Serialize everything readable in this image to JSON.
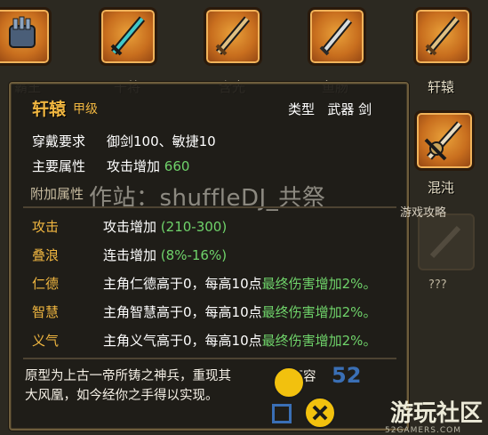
{
  "top_items": [
    {
      "label": "霸王",
      "icon": "gauntlet-icon"
    },
    {
      "label": "干将",
      "icon": "teal-sword-icon"
    },
    {
      "label": "含光",
      "icon": "golden-sword-icon"
    },
    {
      "label": "鱼肠",
      "icon": "silver-dagger-icon"
    },
    {
      "label": "轩辕",
      "icon": "golden-sword-icon"
    }
  ],
  "side_items": [
    {
      "label": "混沌",
      "icon": "ornate-sword-icon"
    },
    {
      "label": "???",
      "icon": "locked-slot-icon"
    }
  ],
  "tooltip": {
    "name": "轩辕",
    "grade": "甲级",
    "type_label": "类型",
    "type_value": "武器 剑",
    "requirement_key": "穿戴要求",
    "requirement_value": "御剑100、敏捷10",
    "main_attr_key": "主要属性",
    "main_attr_value": "攻击增加",
    "main_attr_number": "660",
    "extra_attr_section": "附加属性",
    "attack_key": "攻击",
    "attack_value": "攻击增加",
    "attack_range": "(210-300)",
    "wave_key": "叠浪",
    "wave_value": "连击增加",
    "wave_range": "(8%-16%)",
    "ren_key": "仁德",
    "ren_value": "主角仁德高于0，每高10点",
    "ren_bonus": "最终伤害增加2%。",
    "zhi_key": "智慧",
    "zhi_value": "主角智慧高于0，每高10点",
    "zhi_bonus": "最终伤害增加2%。",
    "yi_key": "义气",
    "yi_value": "主角义气高于0，每高10点",
    "yi_bonus": "最终伤害增加2%。",
    "lore_1": "原型为上古一帝所铸之神兵，重现其",
    "lore_2": "大风凰，如今经你之手得以实现。",
    "hidden_tail": "的面容"
  },
  "watermarks": {
    "center": "作站：shuffleDJ_共祭",
    "side": "游戏攻略",
    "bottom_brand": "游玩社区",
    "bottom_url": "52GAMERS.COM",
    "bottom_number": "52"
  },
  "colors": {
    "accent_orange": "#f0b640",
    "bonus_green": "#6fd36a",
    "panel_border": "#6e5d3c"
  }
}
